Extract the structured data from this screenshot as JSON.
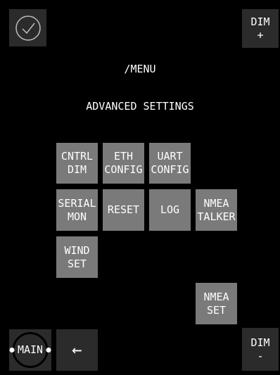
{
  "header": {
    "path": "/MENU",
    "section": "ADVANCED SETTINGS"
  },
  "corners": {
    "confirm_icon": "check-icon",
    "dim_up": "DIM\n+",
    "dim_down": "DIM\n-",
    "main": "MAIN",
    "back_icon": "←"
  },
  "menu": {
    "cntrl_dim": "CNTRL\nDIM",
    "eth_config": "ETH\nCONFIG",
    "uart_config": "UART\nCONFIG",
    "serial_mon": "SERIAL\nMON",
    "reset": "RESET",
    "log": "LOG",
    "nmea_talker": "NMEA\nTALKER",
    "wind_set": "WIND\nSET",
    "nmea_set": "NMEA\nSET"
  },
  "colors": {
    "tile": "#7a7a7a",
    "corner": "#2b2b2b",
    "background": "#000000"
  }
}
